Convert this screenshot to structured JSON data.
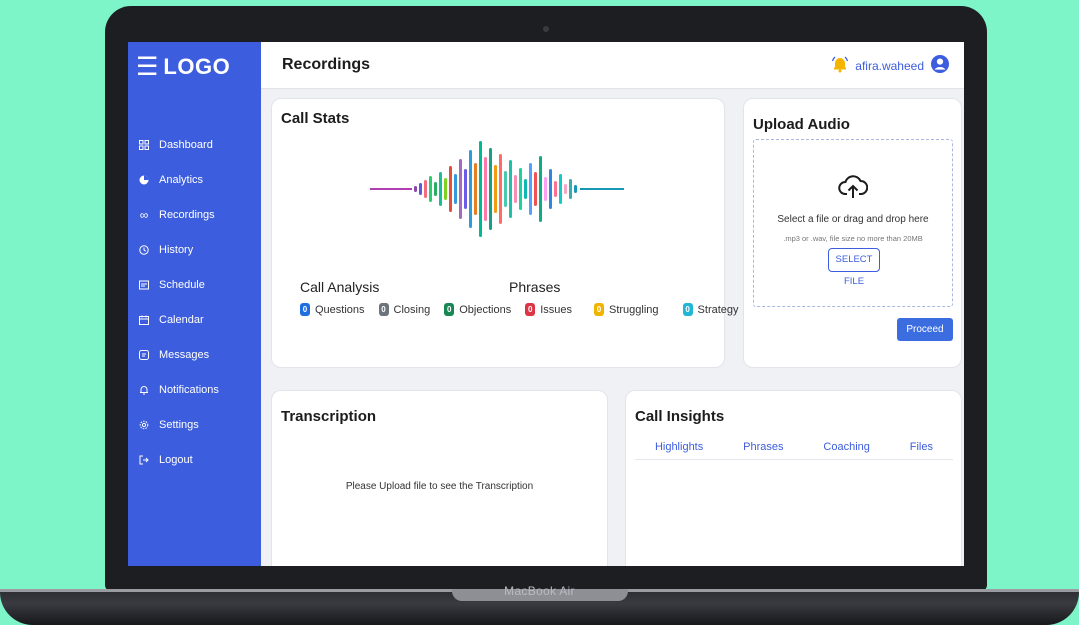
{
  "device": {
    "model": "MacBook Air"
  },
  "sidebar": {
    "logo": "LOGO",
    "items": [
      {
        "label": "Dashboard",
        "icon": "grid-icon"
      },
      {
        "label": "Analytics",
        "icon": "pie-chart-icon"
      },
      {
        "label": "Recordings",
        "icon": "infinity-icon"
      },
      {
        "label": "History",
        "icon": "clock-icon"
      },
      {
        "label": "Schedule",
        "icon": "schedule-icon"
      },
      {
        "label": "Calendar",
        "icon": "calendar-icon"
      },
      {
        "label": "Messages",
        "icon": "message-icon"
      },
      {
        "label": "Notifications",
        "icon": "bell-icon"
      },
      {
        "label": "Settings",
        "icon": "gear-icon"
      },
      {
        "label": "Logout",
        "icon": "logout-icon"
      }
    ]
  },
  "header": {
    "title": "Recordings",
    "username": "afira.waheed"
  },
  "call_stats": {
    "title": "Call Stats",
    "analysis_title": "Call Analysis",
    "phrases_title": "Phrases",
    "analysis": [
      {
        "count": "0",
        "label": "Questions",
        "color": "#1f6fe0"
      },
      {
        "count": "0",
        "label": "Closing",
        "color": "#6c757d"
      },
      {
        "count": "0",
        "label": "Objections",
        "color": "#198754"
      }
    ],
    "phrases": [
      {
        "count": "0",
        "label": "Issues",
        "color": "#dc3545"
      },
      {
        "count": "0",
        "label": "Struggling",
        "color": "#f0b400"
      },
      {
        "count": "0",
        "label": "Strategy",
        "color": "#21b6d6"
      }
    ]
  },
  "upload": {
    "title": "Upload Audio",
    "drop_text": "Select a file or drag and drop here",
    "hint": ".mp3 or .wav, file size no more than 20MB",
    "select_label": "SELECT FILE",
    "proceed_label": "Proceed"
  },
  "transcription": {
    "title": "Transcription",
    "empty_message": "Please Upload file to see the Transcription"
  },
  "insights": {
    "title": "Call Insights",
    "tabs": [
      "Highlights",
      "Phrases",
      "Coaching",
      "Files"
    ]
  },
  "colors": {
    "accent": "#3c5ddd",
    "background": "#7df5c8"
  }
}
